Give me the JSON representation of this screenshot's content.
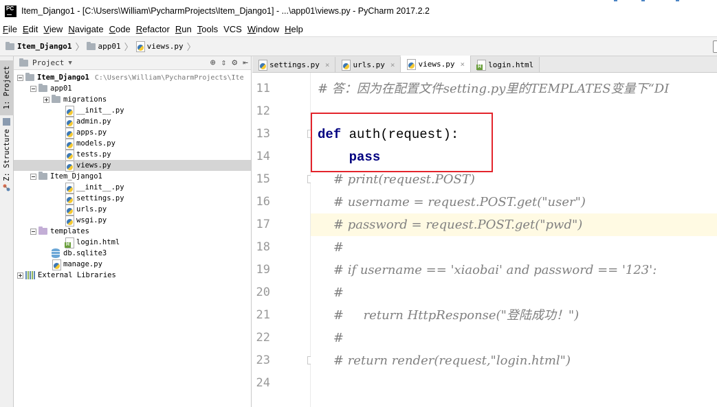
{
  "window": {
    "title": "Item_Django1 - [C:\\Users\\William\\PycharmProjects\\Item_Django1] - ...\\app01\\views.py - PyCharm 2017.2.2",
    "logo_text": "PC"
  },
  "menu": [
    {
      "ul": "F",
      "rest": "ile"
    },
    {
      "ul": "E",
      "rest": "dit"
    },
    {
      "ul": "V",
      "rest": "iew"
    },
    {
      "ul": "N",
      "rest": "avigate"
    },
    {
      "ul": "C",
      "rest": "ode"
    },
    {
      "ul": "R",
      "rest": "efactor"
    },
    {
      "ul": "R",
      "rest": "un"
    },
    {
      "ul": "T",
      "rest": "ools"
    },
    {
      "ul": "",
      "rest": "VCS"
    },
    {
      "ul": "W",
      "rest": "indow"
    },
    {
      "ul": "H",
      "rest": "elp"
    }
  ],
  "breadcrumb": [
    "Item_Django1",
    "app01",
    "views.py"
  ],
  "toolstrip": {
    "project_tab": "1: Project",
    "structure_tab": "Z: Structure"
  },
  "project_panel": {
    "title": "Project",
    "root_path": "C:\\Users\\William\\PycharmProjects\\Ite",
    "tree": [
      {
        "label": "Item_Django1",
        "icon": "folder-icon",
        "level": 0,
        "toggle": "minus",
        "bold": true
      },
      {
        "label": "app01",
        "icon": "folder-icon",
        "level": 1,
        "toggle": "minus"
      },
      {
        "label": "migrations",
        "icon": "folder-icon",
        "level": 2,
        "toggle": "plus"
      },
      {
        "label": "__init__.py",
        "icon": "python-file-icon",
        "level": 3
      },
      {
        "label": "admin.py",
        "icon": "python-file-icon",
        "level": 3
      },
      {
        "label": "apps.py",
        "icon": "python-file-icon",
        "level": 3
      },
      {
        "label": "models.py",
        "icon": "python-file-icon",
        "level": 3
      },
      {
        "label": "tests.py",
        "icon": "python-file-icon",
        "level": 3
      },
      {
        "label": "views.py",
        "icon": "python-file-icon",
        "level": 3,
        "selected": true
      },
      {
        "label": "Item_Django1",
        "icon": "folder-icon",
        "level": 1,
        "toggle": "minus"
      },
      {
        "label": "__init__.py",
        "icon": "python-file-icon",
        "level": 3
      },
      {
        "label": "settings.py",
        "icon": "python-file-icon",
        "level": 3
      },
      {
        "label": "urls.py",
        "icon": "python-file-icon",
        "level": 3
      },
      {
        "label": "wsgi.py",
        "icon": "python-file-icon",
        "level": 3
      },
      {
        "label": "templates",
        "icon": "template-folder-icon",
        "level": 1,
        "toggle": "minus"
      },
      {
        "label": "login.html",
        "icon": "html-file-icon",
        "level": 3
      },
      {
        "label": "db.sqlite3",
        "icon": "database-icon",
        "level": 2
      },
      {
        "label": "manage.py",
        "icon": "python-file-icon",
        "level": 2
      },
      {
        "label": "External Libraries",
        "icon": "library-icon",
        "level": 0,
        "toggle": "plus"
      }
    ]
  },
  "editor_tabs": [
    {
      "label": "settings.py",
      "icon": "python-file-icon"
    },
    {
      "label": "urls.py",
      "icon": "python-file-icon"
    },
    {
      "label": "views.py",
      "icon": "python-file-icon",
      "active": true
    },
    {
      "label": "login.html",
      "icon": "html-file-icon"
    }
  ],
  "code": {
    "current_line": 17,
    "lines": [
      {
        "no": "11",
        "text": "# 答：因为在配置文件setting.py里的TEMPLATES变量下“DI",
        "kind": "comment"
      },
      {
        "no": "12",
        "text": "",
        "kind": "plain"
      },
      {
        "no": "13",
        "kw": "def",
        "text": " auth(request):",
        "kind": "def",
        "fold": true
      },
      {
        "no": "14",
        "kw": "pass",
        "text": "",
        "kind": "kwline",
        "indent": "    "
      },
      {
        "no": "15",
        "text": "    # print(request.POST)",
        "kind": "comment",
        "fold": true
      },
      {
        "no": "16",
        "text": "    # username = request.POST.get(\"user\")",
        "kind": "comment"
      },
      {
        "no": "17",
        "text": "    # password = request.POST.get(\"pwd\")",
        "kind": "comment"
      },
      {
        "no": "18",
        "text": "    #",
        "kind": "comment"
      },
      {
        "no": "19",
        "text": "    # if username == 'xiaobai' and password == '123':",
        "kind": "comment"
      },
      {
        "no": "20",
        "text": "    #",
        "kind": "comment"
      },
      {
        "no": "21",
        "text": "    #     return HttpResponse(\"登陆成功！\")",
        "kind": "comment"
      },
      {
        "no": "22",
        "text": "    #",
        "kind": "comment"
      },
      {
        "no": "23",
        "text": "    # return render(request,\"login.html\")",
        "kind": "comment",
        "fold": true
      },
      {
        "no": "24",
        "text": "",
        "kind": "plain"
      }
    ]
  },
  "colors": {
    "keyword": "#000080",
    "comment": "#808080",
    "current_line": "#fffae3",
    "annotation_box": "#e3242b"
  }
}
